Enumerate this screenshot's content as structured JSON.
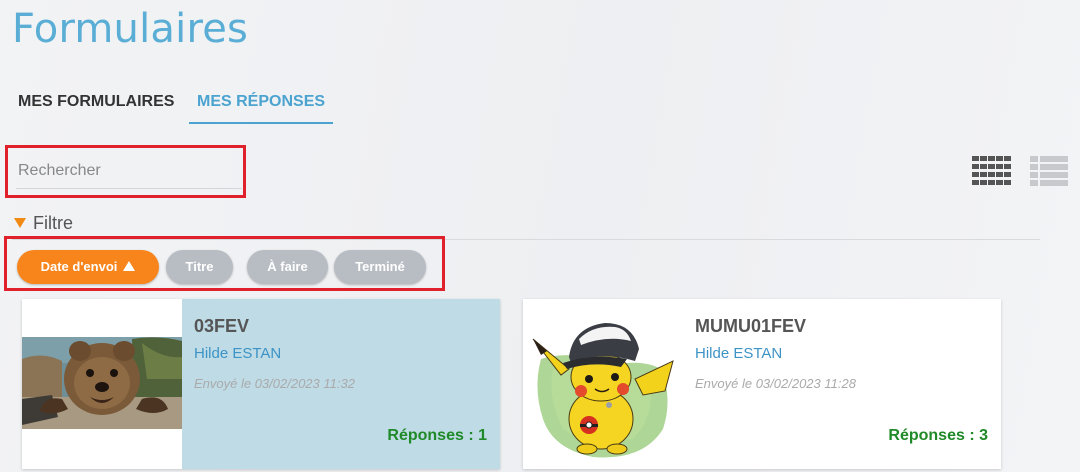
{
  "page": {
    "title": "Formulaires"
  },
  "tabs": [
    {
      "label": "MES FORMULAIRES",
      "active": false
    },
    {
      "label": "MES RÉPONSES",
      "active": true
    }
  ],
  "search": {
    "placeholder": "Rechercher",
    "value": ""
  },
  "view_toggle": {
    "grid_icon": "grid-view-icon",
    "list_icon": "list-view-icon",
    "active": "grid"
  },
  "filter": {
    "label": "Filtre",
    "expanded": true,
    "sort_chips": [
      {
        "label": "Date d'envoi",
        "active": true,
        "direction": "ascending"
      },
      {
        "label": "Titre",
        "active": false
      },
      {
        "label": "À faire",
        "active": false
      },
      {
        "label": "Terminé",
        "active": false
      }
    ]
  },
  "colors": {
    "accent": "#4ba3cf",
    "active_chip": "#f7851c",
    "inactive_chip": "#b8bcc3",
    "count": "#1f8a27"
  },
  "cards": [
    {
      "title": "03FEV",
      "author": "Hilde ESTAN",
      "date": "Envoyé le 03/02/2023 11:32",
      "responses": "Réponses : 1",
      "image": "quokka-photo",
      "selected": true
    },
    {
      "title": "MUMU01FEV",
      "author": "Hilde ESTAN",
      "date": "Envoyé le 03/02/2023 11:28",
      "responses": "Réponses : 3",
      "image": "pikachu-with-cap",
      "selected": false
    }
  ]
}
